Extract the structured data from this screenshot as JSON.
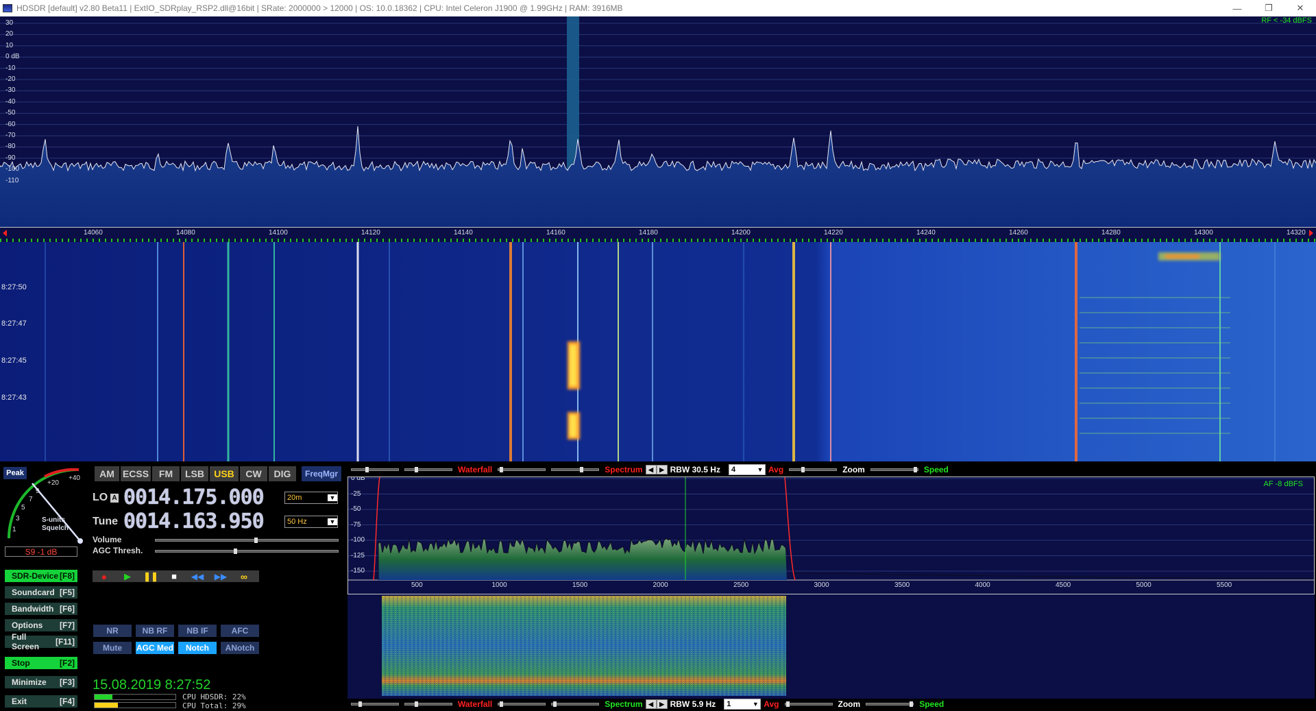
{
  "window": {
    "title": "HDSDR  [default]  v2.80 Beta11  |  ExtIO_SDRplay_RSP2.dll@16bit  |  SRate: 2000000 > 12000  |  OS: 10.0.18362   |  CPU: Intel Celeron  J1900  @ 1.99GHz  |  RAM: 3916MB",
    "minimize": "—",
    "restore": "❐",
    "close": "✕"
  },
  "rf_spectrum": {
    "level_label": "RF < -34 dBFS",
    "db_ticks": [
      "30",
      "20",
      "10",
      "0 dB",
      "-10",
      "-20",
      "-30",
      "-40",
      "-50",
      "-60",
      "-70",
      "-80",
      "-90",
      "-100",
      "-110"
    ],
    "freq_ticks": [
      "14060",
      "14080",
      "14100",
      "14120",
      "14140",
      "14160",
      "14180",
      "14200",
      "14220",
      "14240",
      "14260",
      "14280",
      "14300",
      "14320"
    ]
  },
  "waterfall": {
    "timestamps": [
      "8:27:50",
      "8:27:47",
      "8:27:45",
      "8:27:43"
    ]
  },
  "smeter": {
    "peak_label": "Peak",
    "scale_plus20": "+20",
    "scale_plus40": "+40",
    "scale_s": [
      "9",
      "7",
      "5",
      "3",
      "1"
    ],
    "unit_label": "S-units",
    "squelch_label": "Squelch",
    "reading": "S9 -1 dB"
  },
  "modes": [
    "AM",
    "ECSS",
    "FM",
    "LSB",
    "USB",
    "CW",
    "DIG"
  ],
  "freqmgr": "FreqMgr",
  "lo": {
    "label": "LO",
    "badge": "A",
    "value": "0014.175.000",
    "band": "20m"
  },
  "tune": {
    "label": "Tune",
    "value": "0014.163.950",
    "step": "50 Hz"
  },
  "volume_label": "Volume",
  "agc_thresh_label": "AGC Thresh.",
  "side_buttons": [
    {
      "label": "SDR-Device",
      "key": "[F8]"
    },
    {
      "label": "Soundcard",
      "key": "[F5]"
    },
    {
      "label": "Bandwidth",
      "key": "[F6]"
    },
    {
      "label": "Options",
      "key": "[F7]"
    },
    {
      "label": "Full Screen",
      "key": "[F11]"
    },
    {
      "label": "Stop",
      "key": "[F2]"
    },
    {
      "label": "Minimize",
      "key": "[F3]"
    },
    {
      "label": "Exit",
      "key": "[F4]"
    }
  ],
  "dsp_row1": [
    "NR",
    "NB RF",
    "NB IF",
    "AFC"
  ],
  "dsp_row2": [
    "Mute",
    "AGC Med",
    "Notch",
    "ANotch"
  ],
  "datetime": "15.08.2019 8:27:52",
  "cpu": {
    "hdsdr": "CPU HDSDR: 22%",
    "total": "CPU Total: 29%",
    "hdsdr_fraction": 0.22,
    "total_fraction": 0.29
  },
  "ctrl_top": {
    "waterfall": "Waterfall",
    "spectrum": "Spectrum",
    "rbw": "RBW 30.5 Hz",
    "avg_value": "4",
    "avg": "Avg",
    "zoom": "Zoom",
    "speed": "Speed"
  },
  "ctrl_bottom": {
    "waterfall": "Waterfall",
    "spectrum": "Spectrum",
    "rbw": "RBW  5.9 Hz",
    "avg_value": "1",
    "avg": "Avg",
    "zoom": "Zoom",
    "speed": "Speed"
  },
  "af_spectrum": {
    "level_label": "AF  -8 dBFS",
    "db_ticks": [
      "0 dB",
      "-25",
      "-50",
      "-75",
      "-100",
      "-125",
      "-150"
    ],
    "freq_ticks": [
      "500",
      "1000",
      "1500",
      "2000",
      "2500",
      "3000",
      "3500",
      "4000",
      "4500",
      "5000",
      "5500"
    ]
  },
  "colors": {
    "spectrum_bg": "#0b0f45",
    "waterfall_blue": "#102a8a",
    "active_mode": "#ffd21a",
    "side_green": "#15d33a",
    "dsp_active": "#1aa3ff",
    "label_red": "#ff2020",
    "label_green": "#22e622"
  }
}
